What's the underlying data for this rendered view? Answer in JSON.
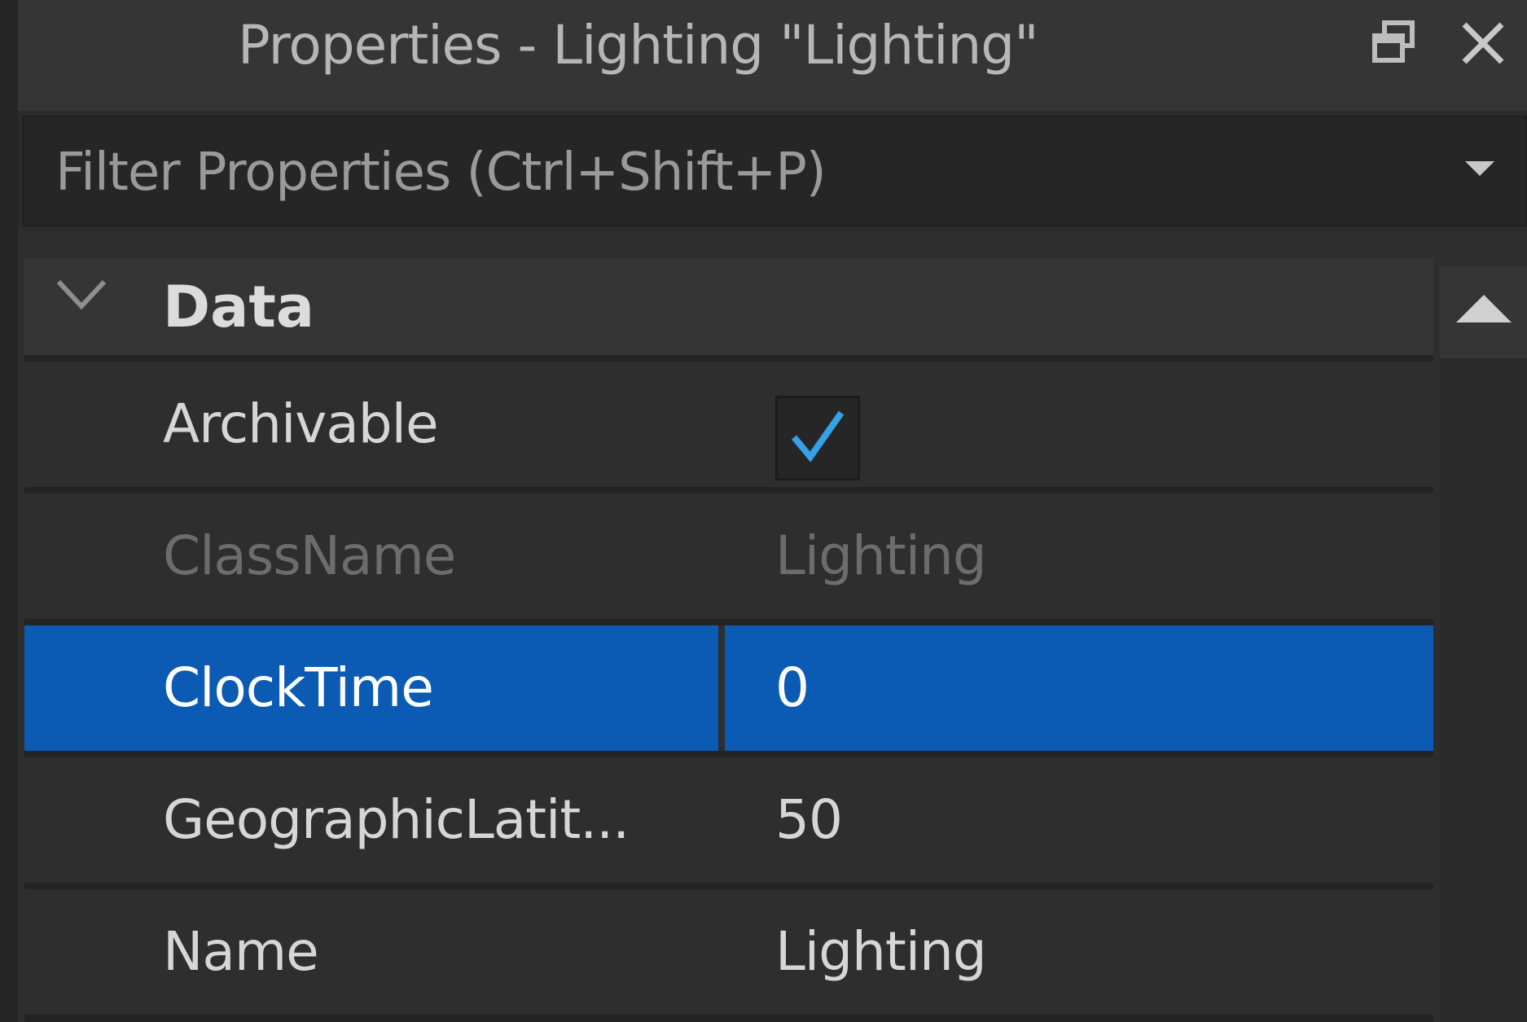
{
  "window": {
    "title": "Properties - Lighting \"Lighting\"",
    "restore_icon": "restore-window-icon",
    "close_icon": "close-icon"
  },
  "filter": {
    "placeholder": "Filter Properties (Ctrl+Shift+P)",
    "dropdown_icon": "caret-down-icon"
  },
  "section": {
    "title": "Data",
    "expanded": true,
    "chevron_icon": "chevron-down-icon"
  },
  "properties": [
    {
      "name": "Archivable",
      "type": "checkbox",
      "checked": true,
      "value": ""
    },
    {
      "name": "ClassName",
      "value": "Lighting",
      "disabled": true
    },
    {
      "name": "ClockTime",
      "value": "0",
      "selected": true
    },
    {
      "name": "GeographicLatit...",
      "value": "50"
    },
    {
      "name": "Name",
      "value": "Lighting"
    }
  ],
  "scrollbar": {
    "up_icon": "scroll-up-arrow-icon"
  },
  "colors": {
    "selection": "#0b5bb5",
    "checkmark": "#35a2e8",
    "panel_bg": "#2e2e2e"
  }
}
